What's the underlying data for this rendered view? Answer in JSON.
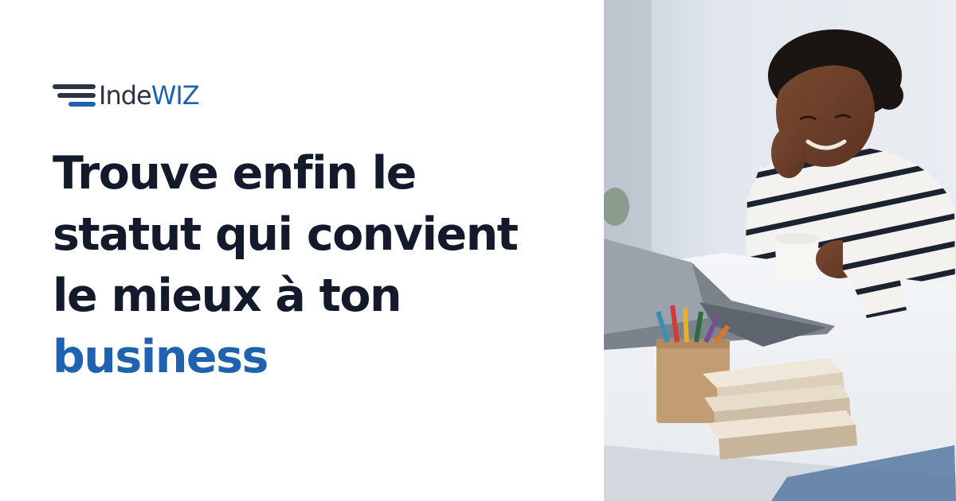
{
  "brand": {
    "name_part1": "Inde",
    "name_part2": "WIZ",
    "colors": {
      "dark": "#2b3442",
      "accent": "#1f63b0"
    }
  },
  "headline": {
    "line1": "Trouve enfin le",
    "line2": "statut qui convient",
    "line3": "le mieux à ton",
    "line4": "business",
    "color": "#121a2b",
    "accent_color": "#1f63b0"
  },
  "photo": {
    "icon": "woman-laptop-photo"
  }
}
